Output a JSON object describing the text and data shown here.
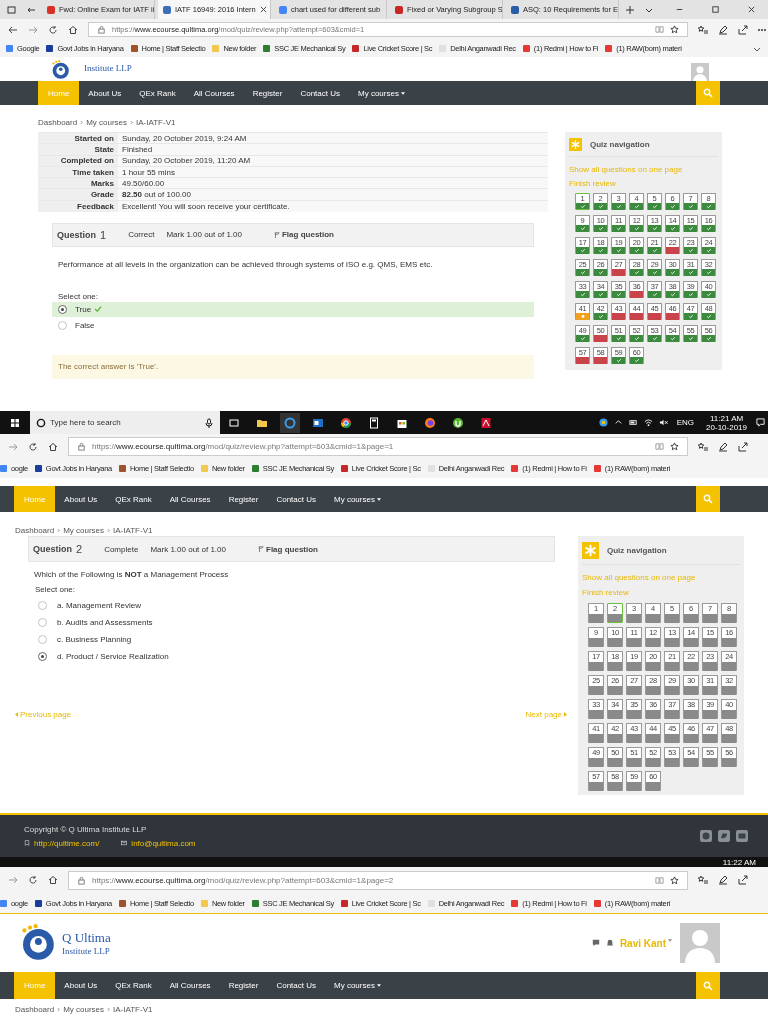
{
  "screens": [
    {
      "tabs": [
        {
          "label": "Fwd: Online Exam for IATF ii",
          "color": "#d93025",
          "selected": false
        },
        {
          "label": "IATF 16949: 2016 Intern",
          "color": "#3b6fb6",
          "selected": true
        },
        {
          "label": "chart used for different sub",
          "color": "#4285f4",
          "selected": false
        },
        {
          "label": "Fixed or Varying Subgroup S",
          "color": "#c62828",
          "selected": false
        },
        {
          "label": "ASQ: 10 Requirements for E",
          "color": "#2b5ca8",
          "selected": false
        }
      ],
      "address_bar": {
        "url": "https://**www.ecourse.qultima.org**/mod/quiz/review.php?attempt=603&cmid=1"
      },
      "bookmarks": [
        {
          "label": "Google",
          "color": "#4285f4"
        },
        {
          "label": "Govt Jobs in Haryana",
          "color": "#1a3d9e"
        },
        {
          "label": "Home | Staff Selectio",
          "color": "#a0522d"
        },
        {
          "label": "New folder",
          "color": "#f2c94c"
        },
        {
          "label": "SSC JE Mechanical Sy",
          "color": "#2e7d32"
        },
        {
          "label": "Live Cricket Score | Sc",
          "color": "#c62828"
        },
        {
          "label": "Delhi Anganwadi Rec",
          "color": "#e0e0e0"
        },
        {
          "label": "(1) Redmi | How to Fi",
          "color": "#e53935"
        },
        {
          "label": "(1) RAW(bom) materi",
          "color": "#e53935"
        }
      ],
      "header": {
        "subtitle": "Institute LLP"
      },
      "navbar": {
        "items": [
          {
            "label": "Home",
            "selected": true
          },
          {
            "label": "About Us",
            "selected": false
          },
          {
            "label": "QEx Rank",
            "selected": false
          },
          {
            "label": "All Courses",
            "selected": false
          },
          {
            "label": "Register",
            "selected": false
          },
          {
            "label": "Contact Us",
            "selected": false
          },
          {
            "label": "My courses",
            "selected": false,
            "kind": "menu"
          }
        ]
      },
      "breadcrumb": [
        "Dashboard",
        "My courses",
        "IA-IATF-V1"
      ],
      "summary": [
        {
          "label": "Started on",
          "value": "Sunday, 20 October 2019, 9:24 AM"
        },
        {
          "label": "State",
          "value": "Finished"
        },
        {
          "label": "Completed on",
          "value": "Sunday, 20 October 2019, 11:20 AM"
        },
        {
          "label": "Time taken",
          "value": "1 hour 55 mins"
        },
        {
          "label": "Marks",
          "value": "49.50/60.00"
        },
        {
          "label": "Grade",
          "value": "**82.50** out of 100.00"
        },
        {
          "label": "Feedback",
          "value": "Excellent! You will soon receive your certificate."
        }
      ],
      "question": {
        "title": "Question",
        "number": "1",
        "status": "Correct",
        "mark": "Mark 1.00 out of 1.00",
        "flag": "Flag question",
        "text": "Performance at all levels in the organization can be achieved through systems of ISO e.g. QMS, EMS etc.",
        "prompt": "Select one:",
        "options": [
          {
            "label": "True",
            "selected": true,
            "correct": true
          },
          {
            "label": "False",
            "selected": false,
            "correct": false
          }
        ],
        "feedback": "The correct answer is 'True'."
      },
      "quiz_nav": {
        "title": "Quiz navigation",
        "links": [
          "Show all questions on one page",
          "Finish review"
        ],
        "buttons": [
          {
            "label": "1",
            "kind": "correct",
            "selected": true
          },
          {
            "label": "2",
            "kind": "correct",
            "selected": false
          },
          {
            "label": "3",
            "kind": "correct",
            "selected": false
          },
          {
            "label": "4",
            "kind": "correct",
            "selected": false
          },
          {
            "label": "5",
            "kind": "correct",
            "selected": false
          },
          {
            "label": "6",
            "kind": "correct",
            "selected": false
          },
          {
            "label": "7",
            "kind": "correct",
            "selected": false
          },
          {
            "label": "8",
            "kind": "correct",
            "selected": false
          },
          {
            "label": "9",
            "kind": "correct",
            "selected": false
          },
          {
            "label": "10",
            "kind": "correct",
            "selected": false
          },
          {
            "label": "11",
            "kind": "correct",
            "selected": false
          },
          {
            "label": "12",
            "kind": "correct",
            "selected": false
          },
          {
            "label": "13",
            "kind": "correct",
            "selected": false
          },
          {
            "label": "14",
            "kind": "correct",
            "selected": false
          },
          {
            "label": "15",
            "kind": "correct",
            "selected": false
          },
          {
            "label": "16",
            "kind": "correct",
            "selected": false
          },
          {
            "label": "17",
            "kind": "correct",
            "selected": false
          },
          {
            "label": "18",
            "kind": "correct",
            "selected": false
          },
          {
            "label": "19",
            "kind": "correct",
            "selected": false
          },
          {
            "label": "20",
            "kind": "correct",
            "selected": false
          },
          {
            "label": "21",
            "kind": "correct",
            "selected": false
          },
          {
            "label": "22",
            "kind": "incorrect",
            "selected": false
          },
          {
            "label": "23",
            "kind": "correct",
            "selected": false
          },
          {
            "label": "24",
            "kind": "correct",
            "selected": false
          },
          {
            "label": "25",
            "kind": "correct",
            "selected": false
          },
          {
            "label": "26",
            "kind": "correct",
            "selected": false
          },
          {
            "label": "27",
            "kind": "incorrect",
            "selected": false
          },
          {
            "label": "28",
            "kind": "correct",
            "selected": false
          },
          {
            "label": "29",
            "kind": "correct",
            "selected": false
          },
          {
            "label": "30",
            "kind": "correct",
            "selected": false
          },
          {
            "label": "31",
            "kind": "correct",
            "selected": false
          },
          {
            "label": "32",
            "kind": "correct",
            "selected": false
          },
          {
            "label": "33",
            "kind": "correct",
            "selected": false
          },
          {
            "label": "34",
            "kind": "correct",
            "selected": false
          },
          {
            "label": "35",
            "kind": "correct",
            "selected": false
          },
          {
            "label": "36",
            "kind": "incorrect",
            "selected": false
          },
          {
            "label": "37",
            "kind": "correct",
            "selected": false
          },
          {
            "label": "38",
            "kind": "correct",
            "selected": false
          },
          {
            "label": "39",
            "kind": "correct",
            "selected": false
          },
          {
            "label": "40",
            "kind": "correct",
            "selected": false
          },
          {
            "label": "41",
            "kind": "partial",
            "selected": false
          },
          {
            "label": "42",
            "kind": "correct",
            "selected": false
          },
          {
            "label": "43",
            "kind": "incorrect",
            "selected": false
          },
          {
            "label": "44",
            "kind": "incorrect",
            "selected": false
          },
          {
            "label": "45",
            "kind": "incorrect",
            "selected": false
          },
          {
            "label": "46",
            "kind": "incorrect",
            "selected": false
          },
          {
            "label": "47",
            "kind": "correct",
            "selected": false
          },
          {
            "label": "48",
            "kind": "correct",
            "selected": false
          },
          {
            "label": "49",
            "kind": "correct",
            "selected": false
          },
          {
            "label": "50",
            "kind": "incorrect",
            "selected": false
          },
          {
            "label": "51",
            "kind": "correct",
            "selected": false
          },
          {
            "label": "52",
            "kind": "correct",
            "selected": false
          },
          {
            "label": "53",
            "kind": "correct",
            "selected": false
          },
          {
            "label": "54",
            "kind": "correct",
            "selected": false
          },
          {
            "label": "55",
            "kind": "correct",
            "selected": false
          },
          {
            "label": "56",
            "kind": "correct",
            "selected": false
          },
          {
            "label": "57",
            "kind": "incorrect",
            "selected": false
          },
          {
            "label": "58",
            "kind": "incorrect",
            "selected": false
          },
          {
            "label": "59",
            "kind": "correct",
            "selected": false
          },
          {
            "label": "60",
            "kind": "correct",
            "selected": false
          }
        ]
      },
      "taskbar": {
        "search_placeholder": "Type here to search",
        "language": "ENG",
        "time": "11:21 AM",
        "date": "20-10-2019"
      }
    },
    {
      "address_bar": {
        "url": "https://**www.ecourse.qultima.org**/mod/quiz/review.php?attempt=603&cmid=1&page=1"
      },
      "bookmarks": [
        {
          "label": "oogle",
          "color": "#4285f4"
        },
        {
          "label": "Govt Jobs in Haryana",
          "color": "#1a3d9e"
        },
        {
          "label": "Home | Staff Selectio",
          "color": "#a0522d"
        },
        {
          "label": "New folder",
          "color": "#f2c94c"
        },
        {
          "label": "SSC JE Mechanical Sy",
          "color": "#2e7d32"
        },
        {
          "label": "Live Cricket Score | Sc",
          "color": "#c62828"
        },
        {
          "label": "Delhi Anganwadi Rec",
          "color": "#e0e0e0"
        },
        {
          "label": "(1) Redmi | How to Fi",
          "color": "#e53935"
        },
        {
          "label": "(1) RAW(bom) materi",
          "color": "#e53935"
        }
      ],
      "navbar": {
        "items": [
          {
            "label": "Home",
            "selected": true
          },
          {
            "label": "About Us",
            "selected": false
          },
          {
            "label": "QEx Rank",
            "selected": false
          },
          {
            "label": "All Courses",
            "selected": false
          },
          {
            "label": "Register",
            "selected": false
          },
          {
            "label": "Contact Us",
            "selected": false
          },
          {
            "label": "My courses",
            "selected": false,
            "kind": "menu"
          }
        ]
      },
      "breadcrumb": [
        "Dashboard",
        "My courses",
        "IA-IATF-V1"
      ],
      "question": {
        "title": "Question",
        "number": "2",
        "status": "Complete",
        "mark": "Mark 1.00 out of 1.00",
        "flag": "Flag question",
        "text": "Which of the Following is **NOT** a Management Process",
        "prompt": "Select one:",
        "options": [
          {
            "label": "a. Management Review",
            "selected": false
          },
          {
            "label": "b. Audits and Assessments",
            "selected": false
          },
          {
            "label": "c. Business Planning",
            "selected": false
          },
          {
            "label": "d. Product / Service Realization",
            "selected": true
          }
        ]
      },
      "pager": {
        "previous": "Previous page",
        "next": "Next page"
      },
      "quiz_nav": {
        "title": "Quiz navigation",
        "links": [
          "Show all questions on one page",
          "Finish review"
        ],
        "buttons": [
          {
            "label": "1",
            "kind": "plain",
            "selected": false
          },
          {
            "label": "2",
            "kind": "plain",
            "selected": true
          },
          {
            "label": "3",
            "kind": "plain",
            "selected": false
          },
          {
            "label": "4",
            "kind": "plain",
            "selected": false
          },
          {
            "label": "5",
            "kind": "plain",
            "selected": false
          },
          {
            "label": "6",
            "kind": "plain",
            "selected": false
          },
          {
            "label": "7",
            "kind": "plain",
            "selected": false
          },
          {
            "label": "8",
            "kind": "plain",
            "selected": false
          },
          {
            "label": "9",
            "kind": "plain",
            "selected": false
          },
          {
            "label": "10",
            "kind": "plain",
            "selected": false
          },
          {
            "label": "11",
            "kind": "plain",
            "selected": false
          },
          {
            "label": "12",
            "kind": "plain",
            "selected": false
          },
          {
            "label": "13",
            "kind": "plain",
            "selected": false
          },
          {
            "label": "14",
            "kind": "plain",
            "selected": false
          },
          {
            "label": "15",
            "kind": "plain",
            "selected": false
          },
          {
            "label": "16",
            "kind": "plain",
            "selected": false
          },
          {
            "label": "17",
            "kind": "plain",
            "selected": false
          },
          {
            "label": "18",
            "kind": "plain",
            "selected": false
          },
          {
            "label": "19",
            "kind": "plain",
            "selected": false
          },
          {
            "label": "20",
            "kind": "plain",
            "selected": false
          },
          {
            "label": "21",
            "kind": "plain",
            "selected": false
          },
          {
            "label": "22",
            "kind": "plain",
            "selected": false
          },
          {
            "label": "23",
            "kind": "plain",
            "selected": false
          },
          {
            "label": "24",
            "kind": "plain",
            "selected": false
          },
          {
            "label": "25",
            "kind": "plain",
            "selected": false
          },
          {
            "label": "26",
            "kind": "plain",
            "selected": false
          },
          {
            "label": "27",
            "kind": "plain",
            "selected": false
          },
          {
            "label": "28",
            "kind": "plain",
            "selected": false
          },
          {
            "label": "29",
            "kind": "plain",
            "selected": false
          },
          {
            "label": "30",
            "kind": "plain",
            "selected": false
          },
          {
            "label": "31",
            "kind": "plain",
            "selected": false
          },
          {
            "label": "32",
            "kind": "plain",
            "selected": false
          },
          {
            "label": "33",
            "kind": "plain",
            "selected": false
          },
          {
            "label": "34",
            "kind": "plain",
            "selected": false
          },
          {
            "label": "35",
            "kind": "plain",
            "selected": false
          },
          {
            "label": "36",
            "kind": "plain",
            "selected": false
          },
          {
            "label": "37",
            "kind": "plain",
            "selected": false
          },
          {
            "label": "38",
            "kind": "plain",
            "selected": false
          },
          {
            "label": "39",
            "kind": "plain",
            "selected": false
          },
          {
            "label": "40",
            "kind": "plain",
            "selected": false
          },
          {
            "label": "41",
            "kind": "plain",
            "selected": false
          },
          {
            "label": "42",
            "kind": "plain",
            "selected": false
          },
          {
            "label": "43",
            "kind": "plain",
            "selected": false
          },
          {
            "label": "44",
            "kind": "plain",
            "selected": false
          },
          {
            "label": "45",
            "kind": "plain",
            "selected": false
          },
          {
            "label": "46",
            "kind": "plain",
            "selected": false
          },
          {
            "label": "47",
            "kind": "plain",
            "selected": false
          },
          {
            "label": "48",
            "kind": "plain",
            "selected": false
          },
          {
            "label": "49",
            "kind": "plain",
            "selected": false
          },
          {
            "label": "50",
            "kind": "plain",
            "selected": false
          },
          {
            "label": "51",
            "kind": "plain",
            "selected": false
          },
          {
            "label": "52",
            "kind": "plain",
            "selected": false
          },
          {
            "label": "53",
            "kind": "plain",
            "selected": false
          },
          {
            "label": "54",
            "kind": "plain",
            "selected": false
          },
          {
            "label": "55",
            "kind": "plain",
            "selected": false
          },
          {
            "label": "56",
            "kind": "plain",
            "selected": false
          },
          {
            "label": "57",
            "kind": "plain",
            "selected": false
          },
          {
            "label": "58",
            "kind": "plain",
            "selected": false
          },
          {
            "label": "59",
            "kind": "plain",
            "selected": false
          },
          {
            "label": "60",
            "kind": "plain",
            "selected": false
          }
        ]
      },
      "footer": {
        "copyright": "Copyright © Q Ultima Institute LLP",
        "website": "http://qultime.com/",
        "email": "info@qultima.com"
      },
      "taskbar": {
        "time": "11:22 AM"
      }
    },
    {
      "address_bar": {
        "url": "https://**www.ecourse.qultima.org**/mod/quiz/review.php?attempt=603&cmid=1&page=2"
      },
      "bookmarks": [
        {
          "label": "oogle",
          "color": "#4285f4"
        },
        {
          "label": "Govt Jobs in Haryana",
          "color": "#1a3d9e"
        },
        {
          "label": "Home | Staff Selectio",
          "color": "#a0522d"
        },
        {
          "label": "New folder",
          "color": "#f2c94c"
        },
        {
          "label": "SSC JE Mechanical Sy",
          "color": "#2e7d32"
        },
        {
          "label": "Live Cricket Score | Sc",
          "color": "#c62828"
        },
        {
          "label": "Delhi Anganwadi Rec",
          "color": "#e0e0e0"
        },
        {
          "label": "(1) Redmi | How to Fi",
          "color": "#e53935"
        },
        {
          "label": "(1) RAW(bom) materi",
          "color": "#e53935"
        }
      ],
      "header": {
        "title": "Q Ultima",
        "subtitle": "Institute LLP",
        "user": "Ravi Kant"
      },
      "navbar": {
        "items": [
          {
            "label": "Home",
            "selected": true
          },
          {
            "label": "About Us",
            "selected": false
          },
          {
            "label": "QEx Rank",
            "selected": false
          },
          {
            "label": "All Courses",
            "selected": false
          },
          {
            "label": "Register",
            "selected": false
          },
          {
            "label": "Contact Us",
            "selected": false
          },
          {
            "label": "My courses",
            "selected": false,
            "kind": "menu"
          }
        ]
      },
      "breadcrumb": [
        "Dashboard",
        "My courses",
        "IA-IATF-V1"
      ]
    }
  ]
}
